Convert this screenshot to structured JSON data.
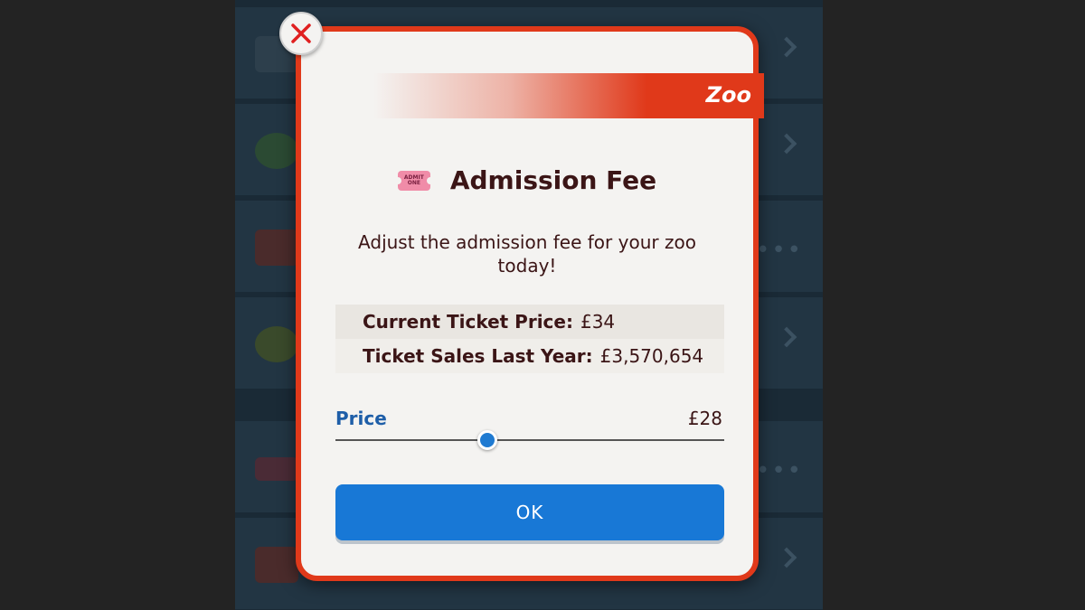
{
  "dialog": {
    "ribbon_label": "Zoo",
    "title": "Admission Fee",
    "ticket_icon_text": "ADMIT ONE",
    "description": "Adjust the admission fee for your zoo today!",
    "current_price_label": "Current Ticket Price:",
    "current_price_value": "£34",
    "sales_label": "Ticket Sales Last Year:",
    "sales_value": "£3,570,654",
    "price_label": "Price",
    "price_value": "£28",
    "slider_level": 0.39,
    "ok_label": "OK"
  },
  "icons": {
    "close": "close-icon",
    "ticket": "ticket-icon"
  },
  "colors": {
    "accent_red": "#e0391a",
    "button_blue": "#1878d6",
    "price_label_blue": "#1e5ea8",
    "text_dark": "#3b1516",
    "close_x": "#e02020"
  }
}
